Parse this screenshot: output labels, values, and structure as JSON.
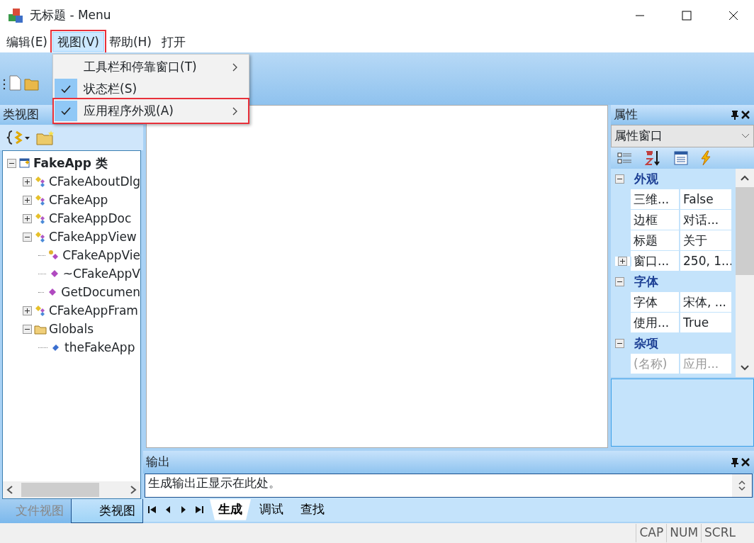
{
  "window": {
    "title": "无标题 - Menu"
  },
  "menu_bar": [
    {
      "label": "编辑(E)",
      "selected": false,
      "highlighted": false
    },
    {
      "label": "视图(V)",
      "selected": true,
      "highlighted": true
    },
    {
      "label": "帮助(H)",
      "selected": false,
      "highlighted": false
    },
    {
      "label": "打开",
      "selected": false,
      "highlighted": false
    }
  ],
  "dropdown": [
    {
      "label": "工具栏和停靠窗口(T)",
      "checked": false,
      "submenu": true,
      "highlighted": false
    },
    {
      "label": "状态栏(S)",
      "checked": true,
      "submenu": false,
      "highlighted": false
    },
    {
      "label": "应用程序外观(A)",
      "checked": true,
      "submenu": true,
      "highlighted": true
    }
  ],
  "class_view": {
    "title": "类视图",
    "tree": [
      {
        "label": "FakeApp 类",
        "kind": "project",
        "expanded": true,
        "children": [
          {
            "label": "CFakeAboutDlg",
            "kind": "class",
            "expanded": false
          },
          {
            "label": "CFakeApp",
            "kind": "class",
            "expanded": false
          },
          {
            "label": "CFakeAppDoc",
            "kind": "class",
            "expanded": false
          },
          {
            "label": "CFakeAppView",
            "kind": "class",
            "expanded": true,
            "children": [
              {
                "label": "CFakeAppVie",
                "kind": "protected-method"
              },
              {
                "label": "~CFakeAppV",
                "kind": "method"
              },
              {
                "label": "GetDocumen",
                "kind": "method"
              }
            ]
          },
          {
            "label": "CFakeAppFram",
            "kind": "class",
            "expanded": false
          },
          {
            "label": "Globals",
            "kind": "folder",
            "expanded": true,
            "children": [
              {
                "label": "theFakeApp",
                "kind": "variable"
              }
            ]
          }
        ]
      }
    ],
    "tabs": [
      {
        "label": "文件视图",
        "selected": false
      },
      {
        "label": "类视图",
        "selected": true
      }
    ]
  },
  "properties": {
    "title": "属性",
    "object": "属性窗口",
    "groups": [
      {
        "label": "外观",
        "expanded": true,
        "rows": [
          {
            "name": "三维...",
            "value": "False",
            "expandable": false,
            "disabled": false
          },
          {
            "name": "边框",
            "value": "对话...",
            "expandable": false,
            "disabled": false
          },
          {
            "name": "标题",
            "value": "关于",
            "expandable": false,
            "disabled": false
          },
          {
            "name": "窗口...",
            "value": "250, 1...",
            "expandable": true,
            "disabled": false
          }
        ]
      },
      {
        "label": "字体",
        "expanded": true,
        "rows": [
          {
            "name": "字体",
            "value": "宋体, ...",
            "expandable": false,
            "disabled": false
          },
          {
            "name": "使用...",
            "value": "True",
            "expandable": false,
            "disabled": false
          }
        ]
      },
      {
        "label": "杂项",
        "expanded": true,
        "rows": [
          {
            "name": "(名称)",
            "value": "应用...",
            "expandable": false,
            "disabled": true
          }
        ]
      }
    ]
  },
  "output": {
    "title": "输出",
    "lines": [
      "生成输出正显示在此处。"
    ],
    "tabs": [
      {
        "label": "生成",
        "selected": true
      },
      {
        "label": "调试",
        "selected": false
      },
      {
        "label": "查找",
        "selected": false
      }
    ]
  },
  "status_bar": [
    "CAP",
    "NUM",
    "SCRL"
  ]
}
